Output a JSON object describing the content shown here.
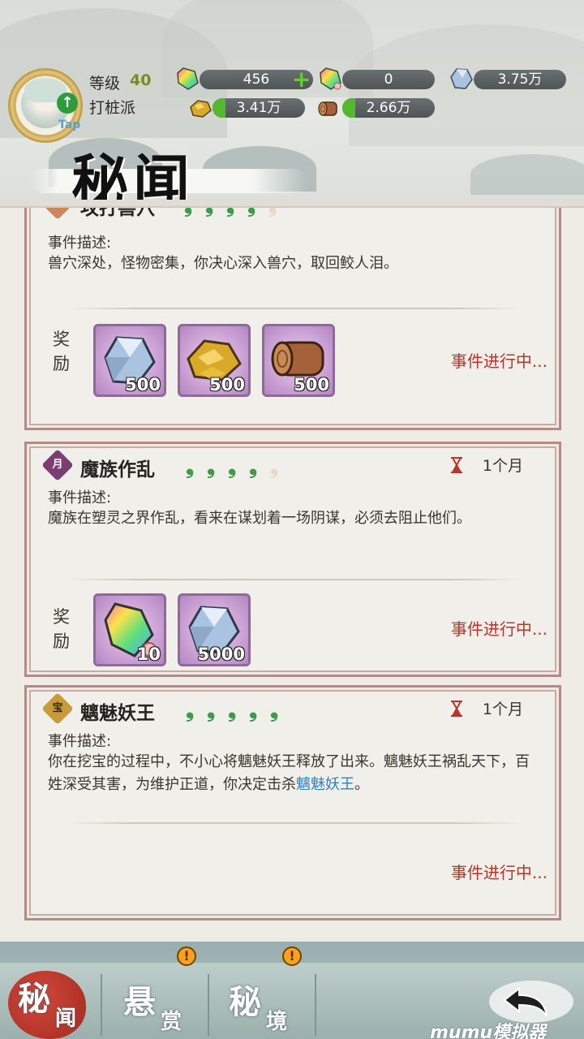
{
  "header": {
    "level_label": "等级",
    "level_value": "40",
    "sect_label": "打桩派",
    "avatar_tap": "Tap",
    "resources": {
      "jade": "456",
      "rainbow_jade": "0",
      "spirit_stone": "3.75万",
      "gold_ore": "3.41万",
      "wood": "2.66万"
    }
  },
  "page_title": "秘闻",
  "events": [
    {
      "title": "攻打兽穴",
      "badge": "",
      "desc_label": "事件描述:",
      "desc": "兽穴深处，怪物密集，你决心深入兽穴，取回鲛人泪。",
      "reward_label": "奖励",
      "rewards": [
        {
          "icon": "spirit-stone-icon",
          "count": "500"
        },
        {
          "icon": "gold-ore-icon",
          "count": "500"
        },
        {
          "icon": "wood-log-icon",
          "count": "500"
        }
      ],
      "status": "事件进行中..."
    },
    {
      "title": "魔族作乱",
      "badge": "月",
      "duration": "1个月",
      "desc_label": "事件描述:",
      "desc": "魔族在塑灵之界作乱，看来在谋划着一场阴谋，必须去阻止他们。",
      "reward_label": "奖励",
      "rewards": [
        {
          "icon": "rainbow-jade-icon",
          "count": "10"
        },
        {
          "icon": "spirit-stone-icon",
          "count": "5000"
        }
      ],
      "status": "事件进行中..."
    },
    {
      "title": "魑魅妖王",
      "badge": "宝",
      "duration": "1个月",
      "desc_label": "事件描述:",
      "desc_main": "你在挖宝的过程中，不小心将魑魅妖王释放了出来。魑魅妖王祸乱天下，百姓深受其害，为维护正道，你决定击杀",
      "desc_highlight": "魑魅妖王",
      "desc_end": "。",
      "status": "事件进行中..."
    }
  ],
  "bottom_nav": {
    "tab1_big": "秘",
    "tab1_small": "闻",
    "tab2_big": "悬",
    "tab2_small": "赏",
    "tab3_big": "秘",
    "tab3_small": "境",
    "alert": "!"
  },
  "watermark": "mumu模拟器",
  "colors": {
    "card_border": "#b48a84",
    "status_red": "#b8352a",
    "leaf_green": "#3e9a4c",
    "highlight_blue": "#2f7fc2",
    "active_tab": "#c23a2e"
  }
}
